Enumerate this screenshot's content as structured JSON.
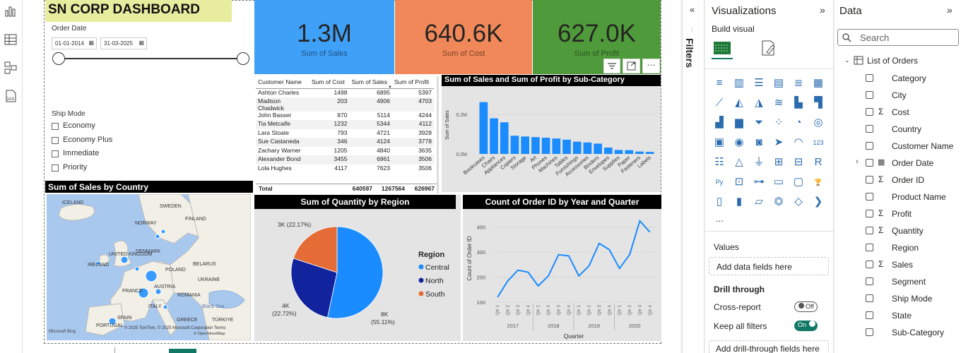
{
  "dashboard": {
    "title": "SN CORP DASHBOARD",
    "order_date": {
      "label": "Order Date",
      "from": "01-01-2014",
      "to": "31-03-2025"
    },
    "ship_mode": {
      "label": "Ship Mode",
      "options": [
        "Economy",
        "Economy Plus",
        "Immediate",
        "Priority"
      ]
    },
    "cards": [
      {
        "value": "1.3M",
        "label": "Sum of Sales",
        "color": "#3fa0f7"
      },
      {
        "value": "640.6K",
        "label": "Sum of Cost",
        "color": "#f0885a"
      },
      {
        "value": "627.0K",
        "label": "Sum of Profit",
        "color": "#4f9a3a"
      }
    ],
    "table": {
      "headers": [
        "Customer Name",
        "Sum of Cost",
        "Sum of Sales",
        "Sum of Profit"
      ],
      "rows": [
        [
          "Ashton Charles",
          "1498",
          "6895",
          "5397"
        ],
        [
          "Madison Chadwick",
          "203",
          "4906",
          "4703"
        ],
        [
          "John Basser",
          "870",
          "5114",
          "4244"
        ],
        [
          "Tia Metcalfe",
          "1232",
          "5344",
          "4112"
        ],
        [
          "Lara Stoate",
          "793",
          "4721",
          "3928"
        ],
        [
          "Sue Castaneda",
          "346",
          "4124",
          "3778"
        ],
        [
          "Zachary Warner",
          "1205",
          "4840",
          "3635"
        ],
        [
          "Alexander Bond",
          "3455",
          "6961",
          "3506"
        ],
        [
          "Lola Hughes",
          "4117",
          "7623",
          "3506"
        ]
      ],
      "total": [
        "Total",
        "640597",
        "1267564",
        "626967"
      ]
    },
    "visual_titles": {
      "subcat": "Sum of Sales and Sum of Profit by Sub-Category",
      "country": "Sum of Sales by Country",
      "region": "Sum of Quantity by Region",
      "orders": "Count of Order ID by Year and Quarter"
    },
    "map": {
      "countries": [
        "ICELAND",
        "SWEDEN",
        "FINLAND",
        "NORWAY",
        "UNITED KINGDOM",
        "DENMARK",
        "IRELAND",
        "BELARUS",
        "POLAND",
        "UKRAINE",
        "FRANCE",
        "AUSTRIA",
        "ROMANIA",
        "ITALY",
        "PORTUGAL",
        "SPAIN",
        "GREECE",
        "TÜRKIYE",
        "Black Sea"
      ],
      "attribution": "© 2025 TomTom, © 2025 Microsoft Corporation  Terms",
      "osm": "© OpenStreetMap",
      "brand": "Microsoft Bing"
    }
  },
  "chart_data": [
    {
      "type": "bar",
      "ylabel": "Sum of Sales",
      "yticks": [
        "0.0M",
        "0.2M"
      ],
      "ylim": [
        0,
        0.3
      ],
      "categories": [
        "Bookcases",
        "Chairs",
        "Appliances",
        "Copiers",
        "Storage",
        "Art",
        "Phones",
        "Machines",
        "Tables",
        "Furnishings",
        "Accessories",
        "Binders",
        "Envelopes",
        "Supplies",
        "Paper",
        "Fasteners",
        "Labels"
      ],
      "values": [
        0.262,
        0.18,
        0.16,
        0.092,
        0.088,
        0.085,
        0.082,
        0.078,
        0.072,
        0.062,
        0.058,
        0.052,
        0.032,
        0.02,
        0.019,
        0.012,
        0.01
      ],
      "color": "#1a8cff"
    },
    {
      "type": "pie",
      "legend_title": "Region",
      "labels": [
        "Central",
        "North",
        "South"
      ],
      "values": [
        8000,
        4000,
        3000
      ],
      "data_labels": [
        "8K\n(55.11%)",
        "4K\n(22.72%)",
        "3K (22.17%)"
      ],
      "colors": [
        "#1a8cff",
        "#12239e",
        "#e66c37"
      ]
    },
    {
      "type": "line",
      "xlabel": "Quarter",
      "ylabel": "Count of Order ID",
      "ylim": [
        100,
        450
      ],
      "yticks": [
        100,
        200,
        300,
        400
      ],
      "years": [
        "2017",
        "2018",
        "2019",
        "2020"
      ],
      "quarters": [
        "Qtr 1",
        "Qtr 2",
        "Qtr 3",
        "Qtr 4"
      ],
      "values": [
        120,
        185,
        228,
        220,
        165,
        205,
        290,
        285,
        205,
        245,
        335,
        310,
        235,
        290,
        425,
        380
      ],
      "color": "#1a8cff"
    }
  ],
  "panes": {
    "filters": "Filters",
    "visualizations": "Visualizations",
    "build_visual": "Build visual",
    "values_label": "Values",
    "values_placeholder": "Add data fields here",
    "drill_through": "Drill through",
    "cross_report": "Cross-report",
    "cross_report_state": "Off",
    "keep_all_filters": "Keep all filters",
    "keep_all_filters_state": "On",
    "drill_placeholder": "Add drill-through fields here",
    "data": "Data",
    "search_placeholder": "Search",
    "table_name": "List of Orders",
    "more": "...",
    "fields": [
      {
        "name": "Category",
        "sigma": false,
        "expand": false
      },
      {
        "name": "City",
        "sigma": false,
        "expand": false
      },
      {
        "name": "Cost",
        "sigma": true,
        "expand": false
      },
      {
        "name": "Country",
        "sigma": false,
        "expand": false
      },
      {
        "name": "Customer Name",
        "sigma": false,
        "expand": false
      },
      {
        "name": "Order Date",
        "sigma": false,
        "expand": true
      },
      {
        "name": "Order ID",
        "sigma": true,
        "expand": false
      },
      {
        "name": "Product Name",
        "sigma": false,
        "expand": false
      },
      {
        "name": "Profit",
        "sigma": true,
        "expand": false
      },
      {
        "name": "Quantity",
        "sigma": true,
        "expand": false
      },
      {
        "name": "Region",
        "sigma": false,
        "expand": false
      },
      {
        "name": "Sales",
        "sigma": true,
        "expand": false
      },
      {
        "name": "Segment",
        "sigma": false,
        "expand": false
      },
      {
        "name": "Ship Mode",
        "sigma": false,
        "expand": false
      },
      {
        "name": "State",
        "sigma": false,
        "expand": false
      },
      {
        "name": "Sub-Category",
        "sigma": false,
        "expand": false
      }
    ]
  }
}
